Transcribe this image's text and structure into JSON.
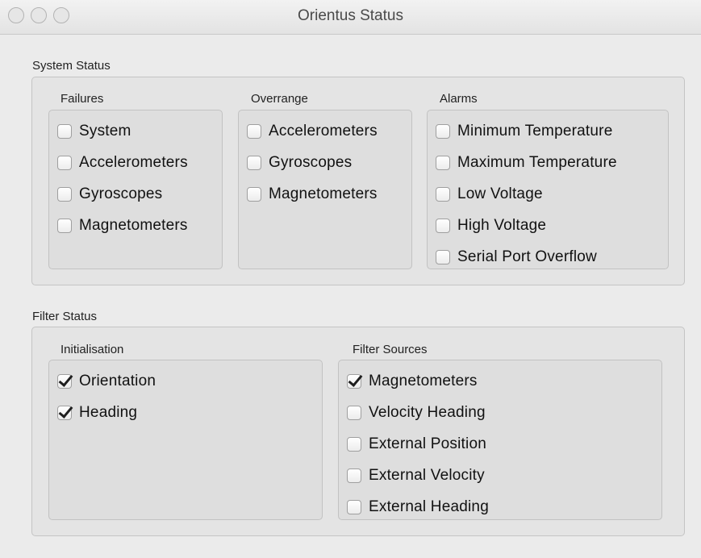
{
  "window": {
    "title": "Orientus Status"
  },
  "system_status": {
    "label": "System Status",
    "failures": {
      "label": "Failures",
      "items": [
        {
          "label": "System",
          "checked": false
        },
        {
          "label": "Accelerometers",
          "checked": false
        },
        {
          "label": "Gyroscopes",
          "checked": false
        },
        {
          "label": "Magnetometers",
          "checked": false
        }
      ]
    },
    "overrange": {
      "label": "Overrange",
      "items": [
        {
          "label": "Accelerometers",
          "checked": false
        },
        {
          "label": "Gyroscopes",
          "checked": false
        },
        {
          "label": "Magnetometers",
          "checked": false
        }
      ]
    },
    "alarms": {
      "label": "Alarms",
      "items": [
        {
          "label": "Minimum Temperature",
          "checked": false
        },
        {
          "label": "Maximum Temperature",
          "checked": false
        },
        {
          "label": "Low Voltage",
          "checked": false
        },
        {
          "label": "High Voltage",
          "checked": false
        },
        {
          "label": "Serial Port Overflow",
          "checked": false
        }
      ]
    }
  },
  "filter_status": {
    "label": "Filter Status",
    "initialisation": {
      "label": "Initialisation",
      "items": [
        {
          "label": "Orientation",
          "checked": true
        },
        {
          "label": "Heading",
          "checked": true
        }
      ]
    },
    "filter_sources": {
      "label": "Filter Sources",
      "items": [
        {
          "label": "Magnetometers",
          "checked": true
        },
        {
          "label": "Velocity Heading",
          "checked": false
        },
        {
          "label": "External Position",
          "checked": false
        },
        {
          "label": "External Velocity",
          "checked": false
        },
        {
          "label": "External Heading",
          "checked": false
        }
      ]
    }
  }
}
